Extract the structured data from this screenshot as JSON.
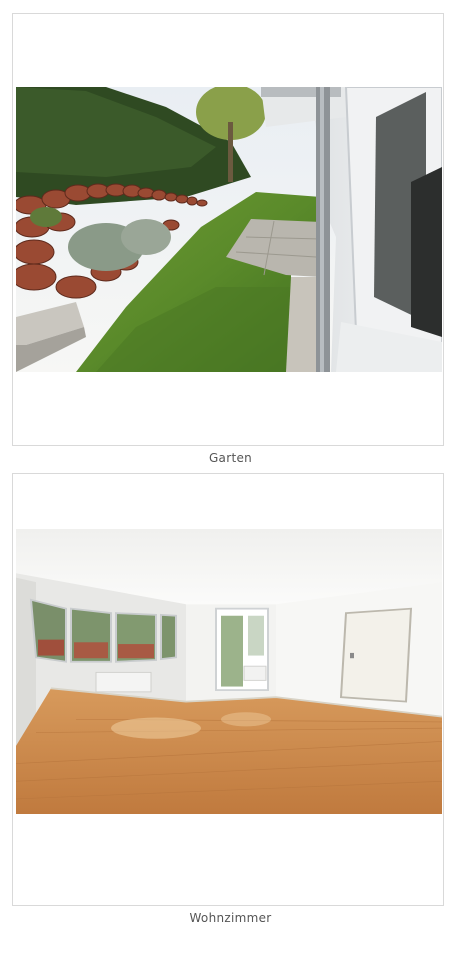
{
  "gallery": {
    "items": [
      {
        "caption": "Garten",
        "image_subject": "garden-photo"
      },
      {
        "caption": "Wohnzimmer",
        "image_subject": "living-room-photo"
      }
    ]
  },
  "colors": {
    "card_border": "#d9d9d9",
    "caption_text": "#555555",
    "background": "#ffffff"
  }
}
